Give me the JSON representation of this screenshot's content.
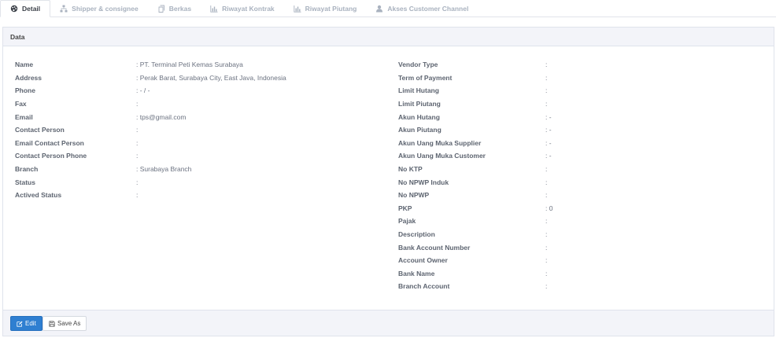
{
  "tabs": [
    {
      "label": "Detail",
      "icon": "palette-icon",
      "active": true
    },
    {
      "label": "Shipper & consignee",
      "icon": "sitemap-icon",
      "active": false
    },
    {
      "label": "Berkas",
      "icon": "files-icon",
      "active": false
    },
    {
      "label": "Riwayat Kontrak",
      "icon": "bar-chart-icon",
      "active": false
    },
    {
      "label": "Riwayat Piutang",
      "icon": "bar-chart-icon",
      "active": false
    },
    {
      "label": "Akses Customer Channel",
      "icon": "user-icon",
      "active": false
    }
  ],
  "panel": {
    "title": "Data"
  },
  "left_fields": [
    {
      "label": "Name",
      "value": ": PT. Terminal Peti Kemas Surabaya"
    },
    {
      "label": "Address",
      "value": ": Perak Barat, Surabaya City, East Java, Indonesia"
    },
    {
      "label": "Phone",
      "value": ": - / -"
    },
    {
      "label": "Fax",
      "value": ":"
    },
    {
      "label": "Email",
      "value": ": tps@gmail.com"
    },
    {
      "label": "Contact Person",
      "value": ":"
    },
    {
      "label": "Email Contact Person",
      "value": ":"
    },
    {
      "label": "Contact Person Phone",
      "value": ":"
    },
    {
      "label": "Branch",
      "value": ": Surabaya Branch"
    },
    {
      "label": "Status",
      "value": ":"
    },
    {
      "label": "Actived Status",
      "value": ":"
    }
  ],
  "right_fields": [
    {
      "label": "Vendor Type",
      "value": ":"
    },
    {
      "label": "Term of Payment",
      "value": ":"
    },
    {
      "label": "Limit Hutang",
      "value": ":"
    },
    {
      "label": "Limit Piutang",
      "value": ":"
    },
    {
      "label": "Akun Hutang",
      "value": ": -"
    },
    {
      "label": "Akun Piutang",
      "value": ": -"
    },
    {
      "label": "Akun Uang Muka Supplier",
      "value": ": -"
    },
    {
      "label": "Akun Uang Muka Customer",
      "value": ": -"
    },
    {
      "label": "No KTP",
      "value": ":"
    },
    {
      "label": "No NPWP Induk",
      "value": ":"
    },
    {
      "label": "No NPWP",
      "value": ":"
    },
    {
      "label": "PKP",
      "value": ": 0"
    },
    {
      "label": "Pajak",
      "value": ":"
    },
    {
      "label": "Description",
      "value": ":"
    },
    {
      "label": "Bank Account Number",
      "value": ":"
    },
    {
      "label": "Account Owner",
      "value": ":"
    },
    {
      "label": "Bank Name",
      "value": ":"
    },
    {
      "label": "Branch Account",
      "value": ":"
    }
  ],
  "footer": {
    "edit_label": "Edit",
    "save_as_label": "Save As"
  },
  "colors": {
    "primary": "#2f7fd1",
    "panel_bg": "#f3f4f9",
    "tab_inactive": "#a9b2bf"
  }
}
